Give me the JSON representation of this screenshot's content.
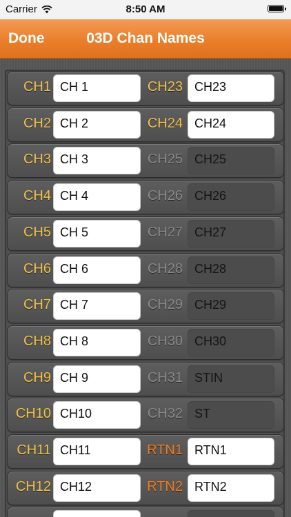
{
  "status_bar": {
    "carrier": "Carrier",
    "time": "8:50 AM"
  },
  "nav": {
    "done_label": "Done",
    "title": "03D Chan Names"
  },
  "rows": [
    {
      "left": {
        "label": "CH1",
        "value": "CH 1",
        "state": "on"
      },
      "right": {
        "label": "CH23",
        "value": "CH23",
        "state": "on"
      }
    },
    {
      "left": {
        "label": "CH2",
        "value": "CH 2",
        "state": "on"
      },
      "right": {
        "label": "CH24",
        "value": "CH24",
        "state": "on"
      }
    },
    {
      "left": {
        "label": "CH3",
        "value": "CH 3",
        "state": "on"
      },
      "right": {
        "label": "CH25",
        "value": "CH25",
        "state": "off"
      }
    },
    {
      "left": {
        "label": "CH4",
        "value": "CH 4",
        "state": "on"
      },
      "right": {
        "label": "CH26",
        "value": "CH26",
        "state": "off"
      }
    },
    {
      "left": {
        "label": "CH5",
        "value": "CH 5",
        "state": "on"
      },
      "right": {
        "label": "CH27",
        "value": "CH27",
        "state": "off"
      }
    },
    {
      "left": {
        "label": "CH6",
        "value": "CH 6",
        "state": "on"
      },
      "right": {
        "label": "CH28",
        "value": "CH28",
        "state": "off"
      }
    },
    {
      "left": {
        "label": "CH7",
        "value": "CH 7",
        "state": "on"
      },
      "right": {
        "label": "CH29",
        "value": "CH29",
        "state": "off"
      }
    },
    {
      "left": {
        "label": "CH8",
        "value": "CH 8",
        "state": "on"
      },
      "right": {
        "label": "CH30",
        "value": "CH30",
        "state": "off"
      }
    },
    {
      "left": {
        "label": "CH9",
        "value": "CH 9",
        "state": "on"
      },
      "right": {
        "label": "CH31",
        "value": "STIN",
        "state": "off"
      }
    },
    {
      "left": {
        "label": "CH10",
        "value": "CH10",
        "state": "on"
      },
      "right": {
        "label": "CH32",
        "value": "ST",
        "state": "off"
      }
    },
    {
      "left": {
        "label": "CH11",
        "value": "CH11",
        "state": "on"
      },
      "right": {
        "label": "RTN1",
        "value": "RTN1",
        "state": "rtn"
      }
    },
    {
      "left": {
        "label": "CH12",
        "value": "CH12",
        "state": "on"
      },
      "right": {
        "label": "RTN2",
        "value": "RTN2",
        "state": "rtn"
      }
    },
    {
      "left": {
        "label": "",
        "value": "",
        "state": "on"
      },
      "right": {
        "label": "",
        "value": "",
        "state": "off"
      }
    }
  ],
  "colors": {
    "accent": "#ea7f2b",
    "label_active": "#f2c24a",
    "label_inactive": "#8a8a8a",
    "label_return": "#ef7a1e"
  }
}
